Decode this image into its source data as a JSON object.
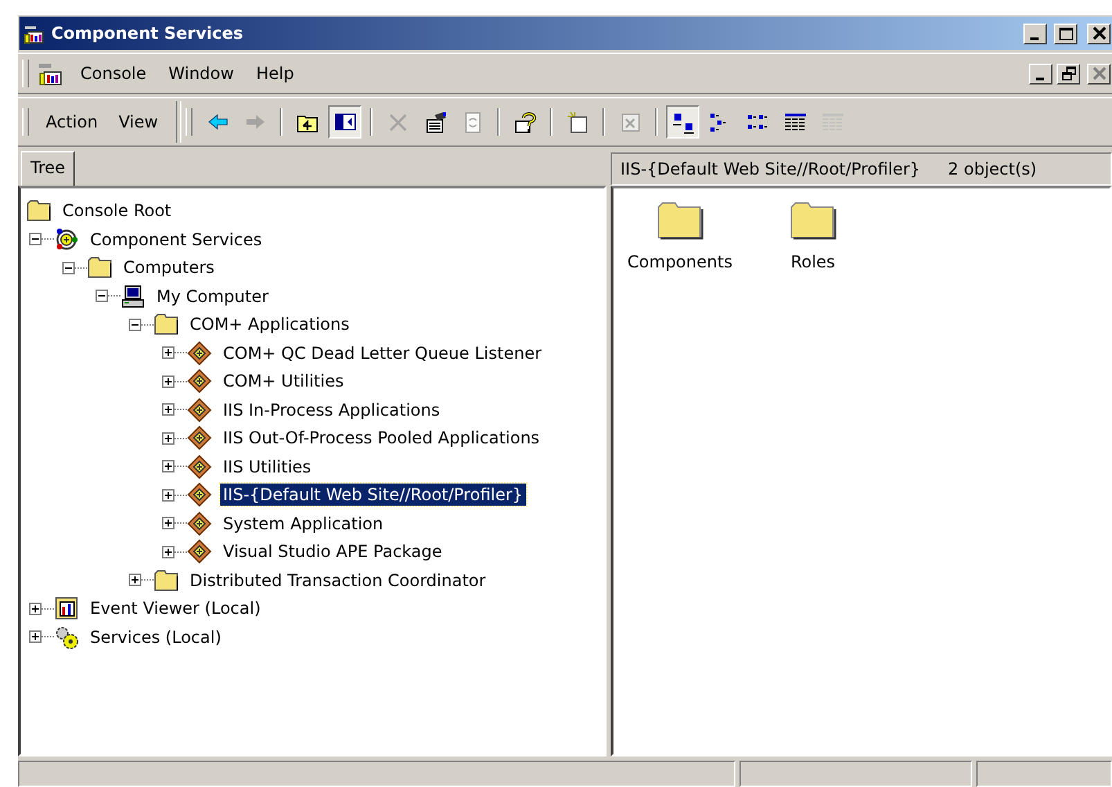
{
  "window": {
    "title": "Component Services",
    "controls": [
      {
        "kind": "minimize"
      },
      {
        "kind": "maximize"
      },
      {
        "kind": "close"
      }
    ]
  },
  "menu_bar": {
    "items": [
      {
        "label": "Console"
      },
      {
        "label": "Window"
      },
      {
        "label": "Help"
      }
    ],
    "child_controls": [
      {
        "kind": "minimize",
        "disabled": false
      },
      {
        "kind": "restore",
        "disabled": false
      },
      {
        "kind": "close",
        "disabled": true
      }
    ]
  },
  "toolbar": {
    "menus": [
      {
        "label": "Action"
      },
      {
        "label": "View"
      }
    ],
    "buttons": [
      {
        "kind": "back",
        "disabled": false,
        "pressed": false
      },
      {
        "kind": "forward",
        "disabled": true,
        "pressed": false
      },
      {
        "kind": "separator"
      },
      {
        "kind": "up",
        "disabled": false,
        "pressed": false
      },
      {
        "kind": "tree-toggle",
        "disabled": false,
        "pressed": true
      },
      {
        "kind": "separator"
      },
      {
        "kind": "delete",
        "disabled": true,
        "pressed": false
      },
      {
        "kind": "properties",
        "disabled": false,
        "pressed": false
      },
      {
        "kind": "refresh",
        "disabled": true,
        "pressed": false
      },
      {
        "kind": "separator"
      },
      {
        "kind": "help",
        "disabled": false,
        "pressed": false
      },
      {
        "kind": "separator"
      },
      {
        "kind": "new-window",
        "disabled": false,
        "pressed": false
      },
      {
        "kind": "separator"
      },
      {
        "kind": "export",
        "disabled": true,
        "pressed": false
      },
      {
        "kind": "separator"
      },
      {
        "kind": "large-icons",
        "disabled": false,
        "pressed": true
      },
      {
        "kind": "small-icons",
        "disabled": false,
        "pressed": false
      },
      {
        "kind": "list",
        "disabled": false,
        "pressed": false
      },
      {
        "kind": "details",
        "disabled": false,
        "pressed": false
      },
      {
        "kind": "filter",
        "disabled": true,
        "pressed": false
      }
    ]
  },
  "tabs": [
    {
      "label": "Tree",
      "selected": true
    }
  ],
  "tree": [
    {
      "label": "Console Root",
      "kind": "folder",
      "selected": false,
      "children": [
        {
          "label": "Component Services",
          "kind": "component-services",
          "selected": false,
          "expanded": true,
          "children": [
            {
              "label": "Computers",
              "kind": "folder",
              "selected": false,
              "expanded": true,
              "children": [
                {
                  "label": "My Computer",
                  "kind": "computer",
                  "selected": false,
                  "expanded": true,
                  "children": [
                    {
                      "label": "COM+ Applications",
                      "kind": "folder",
                      "selected": false,
                      "expanded": true,
                      "children": [
                        {
                          "label": "COM+ QC Dead Letter Queue Listener",
                          "kind": "package",
                          "selected": false,
                          "expanded": false
                        },
                        {
                          "label": "COM+ Utilities",
                          "kind": "package",
                          "selected": false,
                          "expanded": false
                        },
                        {
                          "label": "IIS In-Process Applications",
                          "kind": "package",
                          "selected": false,
                          "expanded": false
                        },
                        {
                          "label": "IIS Out-Of-Process Pooled Applications",
                          "kind": "package",
                          "selected": false,
                          "expanded": false
                        },
                        {
                          "label": "IIS Utilities",
                          "kind": "package",
                          "selected": false,
                          "expanded": false
                        },
                        {
                          "label": "IIS-{Default Web Site//Root/Profiler}",
                          "kind": "package",
                          "selected": true,
                          "expanded": false
                        },
                        {
                          "label": "System Application",
                          "kind": "package",
                          "selected": false,
                          "expanded": false
                        },
                        {
                          "label": "Visual Studio APE Package",
                          "kind": "package",
                          "selected": false,
                          "expanded": false
                        }
                      ]
                    },
                    {
                      "label": "Distributed Transaction Coordinator",
                      "kind": "folder",
                      "selected": false,
                      "expanded": false
                    }
                  ]
                }
              ]
            }
          ]
        },
        {
          "label": "Event Viewer (Local)",
          "kind": "event-viewer",
          "selected": false,
          "expanded": false
        },
        {
          "label": "Services (Local)",
          "kind": "services",
          "selected": false,
          "expanded": false
        }
      ]
    }
  ],
  "details": {
    "title": "IIS-{Default Web Site//Root/Profiler}",
    "count": "2 object(s)",
    "items": [
      {
        "label": "Components",
        "kind": "folder"
      },
      {
        "label": "Roles",
        "kind": "folder"
      }
    ]
  }
}
